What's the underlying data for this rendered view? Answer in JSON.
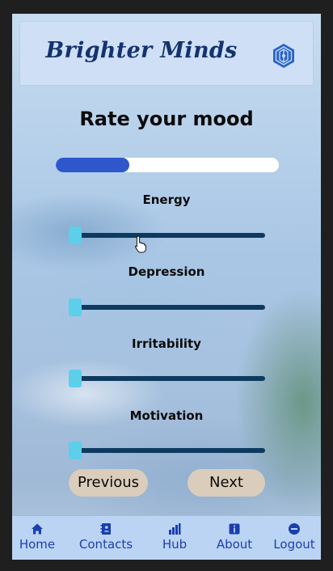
{
  "app": {
    "title": "Brighter Minds"
  },
  "page": {
    "heading": "Rate your mood",
    "progress_fraction": 0.33
  },
  "ratings": [
    {
      "label": "Energy",
      "value": 0
    },
    {
      "label": "Depression",
      "value": 0
    },
    {
      "label": "Irritability",
      "value": 0
    },
    {
      "label": "Motivation",
      "value": 0
    }
  ],
  "buttons": {
    "previous": "Previous",
    "next": "Next"
  },
  "tabs": [
    {
      "label": "Home",
      "icon": "home-icon"
    },
    {
      "label": "Contacts",
      "icon": "contacts-icon"
    },
    {
      "label": "Hub",
      "icon": "hub-icon"
    },
    {
      "label": "About",
      "icon": "info-icon"
    },
    {
      "label": "Logout",
      "icon": "logout-icon"
    }
  ],
  "colors": {
    "brand": "#14336f",
    "progress": "#2f57cc",
    "slider_track": "#0d3a5e",
    "slider_thumb": "#5ccfea",
    "button_bg": "#dacdbb",
    "tab_text": "#1b3fae"
  }
}
